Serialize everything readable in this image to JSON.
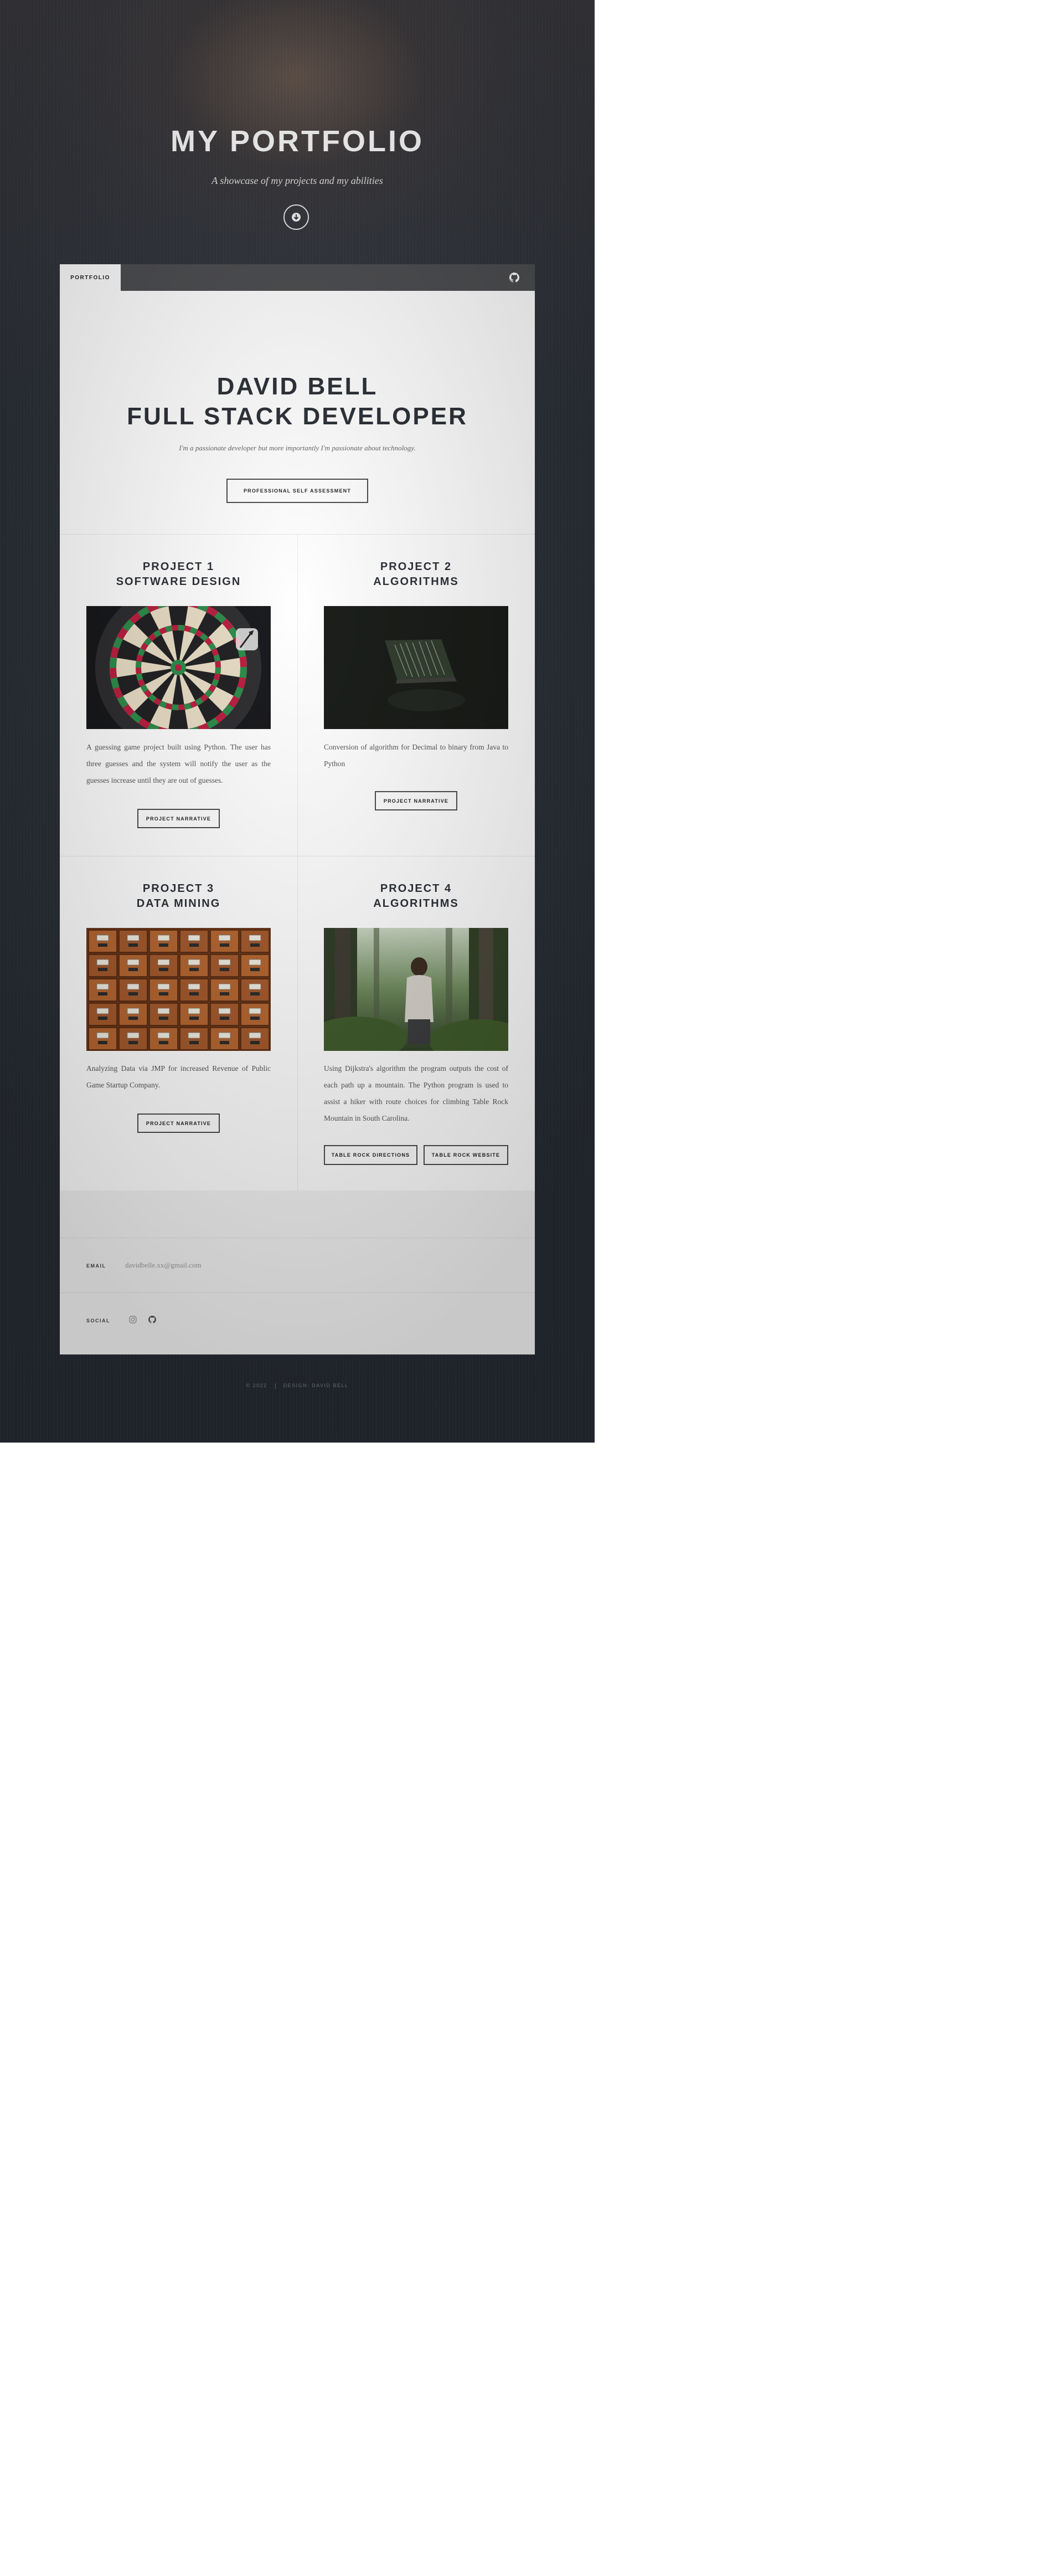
{
  "header": {
    "title": "MY PORTFOLIO",
    "subtitle": "A showcase of my projects and my abilities",
    "scroll_icon": "arrow-down-circle-icon"
  },
  "nav": {
    "active_tab": "PORTFOLIO",
    "github_icon": "github-icon"
  },
  "intro": {
    "name": "DAVID BELL",
    "role": "FULL STACK DEVELOPER",
    "tagline": "I'm a passionate developer but more importantly I'm passionate about technology.",
    "button_label": "PROFESSIONAL SELF ASSESSMENT"
  },
  "projects": [
    {
      "title_line1": "PROJECT 1",
      "title_line2": "SOFTWARE DESIGN",
      "image": "dartboard-photo",
      "description": "A guessing game project built using Python. The user has three guesses and the system will notify the user as the guesses increase until they are out of guesses.",
      "buttons": [
        "PROJECT NARRATIVE"
      ]
    },
    {
      "title_line1": "PROJECT 2",
      "title_line2": "ALGORITHMS",
      "image": "laptop-code-photo",
      "description": "Conversion of algorithm for Decimal to binary from Java to Python",
      "buttons": [
        "PROJECT NARRATIVE"
      ]
    },
    {
      "title_line1": "PROJECT 3",
      "title_line2": "DATA MINING",
      "image": "card-catalog-photo",
      "description": "Analyzing Data via JMP for increased Revenue of Public Game Startup Company.",
      "buttons": [
        "PROJECT NARRATIVE"
      ]
    },
    {
      "title_line1": "PROJECT 4",
      "title_line2": "ALGORITHMS",
      "image": "forest-hiker-photo",
      "description": "Using Dijkstra's algorithm the program outputs the cost of each path up a mountain. The Python program is used to assist a hiker with route choices for climbing Table Rock Mountain in South Carolina.",
      "buttons": [
        "TABLE ROCK DIRECTIONS",
        "TABLE ROCK WEBSITE"
      ]
    }
  ],
  "contact": {
    "email_label": "EMAIL",
    "email_value": "davidbelle.xx@gmail.com",
    "social_label": "SOCIAL",
    "social_icons": [
      "instagram-icon",
      "github-icon"
    ]
  },
  "footer": {
    "copyright": "© 2022",
    "credit": "DESIGN: DAVID BELL"
  },
  "colors": {
    "background_dark": "#262b33",
    "heading": "#2a2e35",
    "topbar": "#4b4c4f",
    "footer_panel": "#f4f4f4"
  }
}
